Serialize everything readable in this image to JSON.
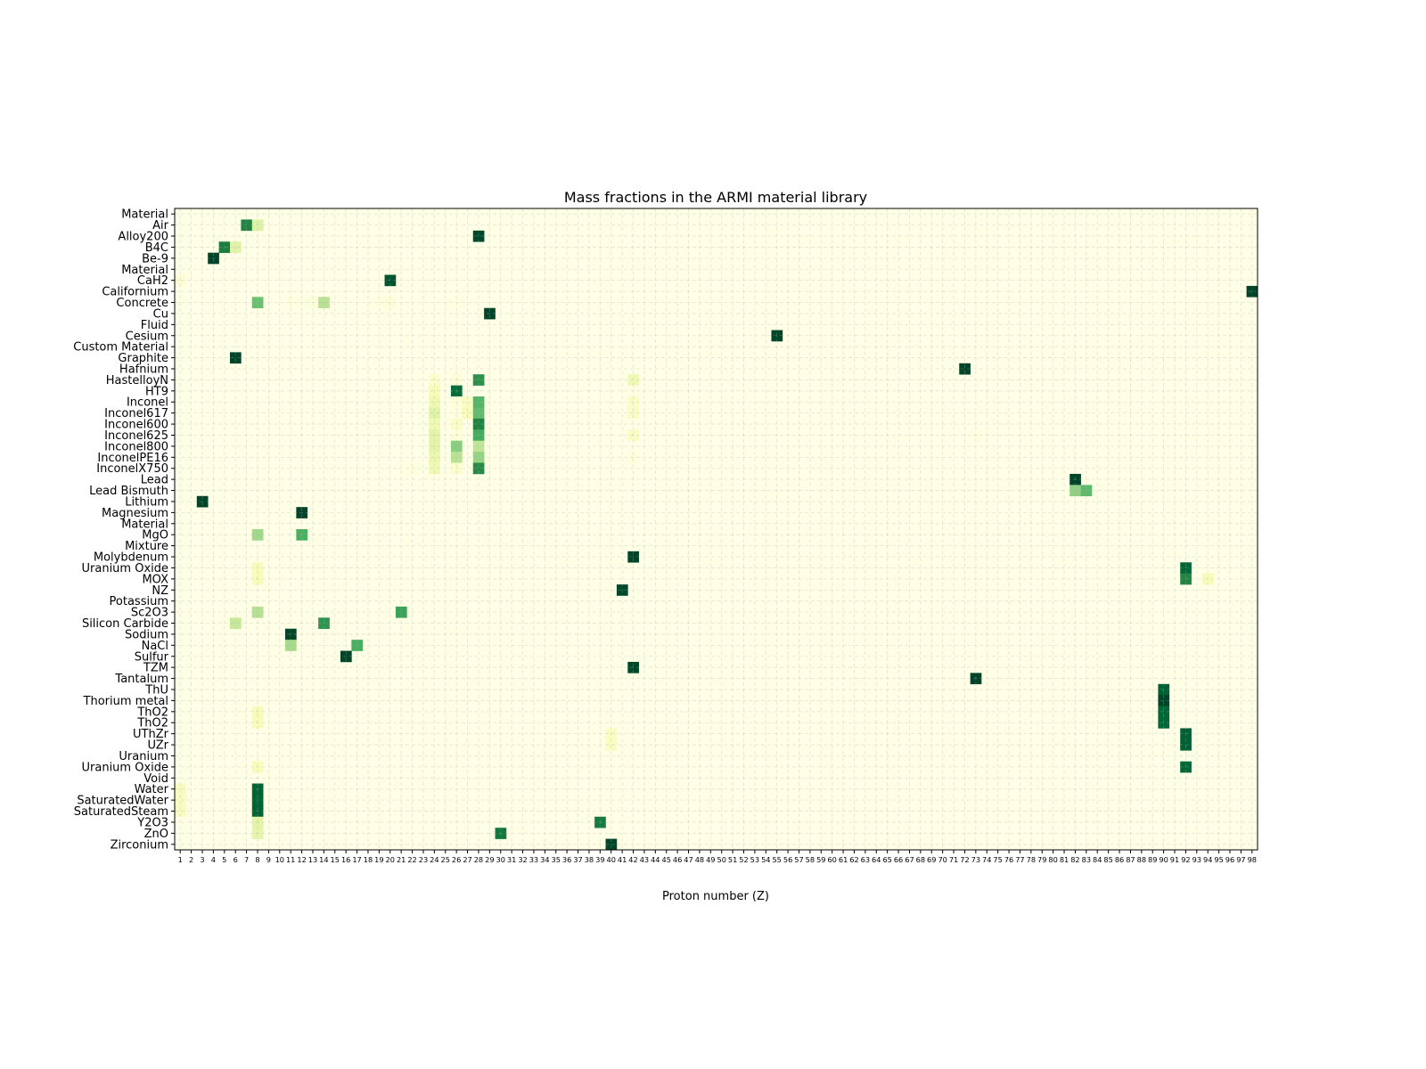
{
  "chart_data": {
    "type": "heatmap",
    "title": "Mass fractions in the ARMI material library",
    "xlabel": "Proton number (Z)",
    "ylabel": "",
    "colormap": "YlGn",
    "value_range": [
      0,
      1
    ],
    "grid": true,
    "x_ticks": [
      1,
      2,
      3,
      4,
      5,
      6,
      7,
      8,
      9,
      10,
      11,
      12,
      13,
      14,
      15,
      16,
      17,
      18,
      19,
      20,
      21,
      22,
      23,
      24,
      25,
      26,
      27,
      28,
      29,
      30,
      31,
      32,
      33,
      34,
      35,
      36,
      37,
      38,
      39,
      40,
      41,
      42,
      43,
      44,
      45,
      46,
      47,
      48,
      49,
      50,
      51,
      52,
      53,
      54,
      55,
      56,
      57,
      58,
      59,
      60,
      61,
      62,
      63,
      64,
      65,
      66,
      67,
      68,
      69,
      70,
      71,
      72,
      73,
      74,
      75,
      76,
      77,
      78,
      79,
      80,
      81,
      82,
      83,
      84,
      85,
      86,
      87,
      88,
      89,
      90,
      91,
      92,
      93,
      94,
      95,
      96,
      97,
      98
    ],
    "rows": [
      {
        "name": "Material",
        "cells": {}
      },
      {
        "name": "Air",
        "cells": {
          "7": 0.755,
          "8": 0.23
        }
      },
      {
        "name": "Alloy200",
        "cells": {
          "28": 0.99
        }
      },
      {
        "name": "B4C",
        "cells": {
          "5": 0.78,
          "6": 0.22
        }
      },
      {
        "name": "Be-9",
        "cells": {
          "4": 1.0
        }
      },
      {
        "name": "Material",
        "cells": {}
      },
      {
        "name": "CaH2",
        "cells": {
          "1": 0.05,
          "20": 0.95
        }
      },
      {
        "name": "Californium",
        "cells": {
          "98": 1.0
        }
      },
      {
        "name": "Concrete",
        "cells": {
          "1": 0.01,
          "8": 0.53,
          "11": 0.02,
          "12": 0.01,
          "13": 0.03,
          "14": 0.34,
          "19": 0.01,
          "20": 0.04,
          "26": 0.01
        }
      },
      {
        "name": "Cu",
        "cells": {
          "29": 1.0
        }
      },
      {
        "name": "Fluid",
        "cells": {}
      },
      {
        "name": "Cesium",
        "cells": {
          "55": 1.0
        }
      },
      {
        "name": "Custom Material",
        "cells": {}
      },
      {
        "name": "Graphite",
        "cells": {
          "6": 1.0
        }
      },
      {
        "name": "Hafnium",
        "cells": {
          "72": 1.0
        }
      },
      {
        "name": "HastelloyN",
        "cells": {
          "24": 0.07,
          "26": 0.04,
          "28": 0.71,
          "42": 0.16
        }
      },
      {
        "name": "HT9",
        "cells": {
          "24": 0.12,
          "26": 0.85,
          "42": 0.01
        }
      },
      {
        "name": "Inconel",
        "cells": {
          "24": 0.16,
          "26": 0.03,
          "27": 0.1,
          "28": 0.58,
          "42": 0.09
        }
      },
      {
        "name": "Inconel617",
        "cells": {
          "24": 0.22,
          "26": 0.02,
          "27": 0.12,
          "28": 0.55,
          "42": 0.09
        }
      },
      {
        "name": "Inconel600",
        "cells": {
          "24": 0.15,
          "26": 0.08,
          "28": 0.76
        }
      },
      {
        "name": "Inconel625",
        "cells": {
          "24": 0.21,
          "26": 0.03,
          "28": 0.62,
          "42": 0.09,
          "73": 0.02
        }
      },
      {
        "name": "Inconel800",
        "cells": {
          "24": 0.21,
          "26": 0.46,
          "28": 0.32
        }
      },
      {
        "name": "InconelPE16",
        "cells": {
          "24": 0.17,
          "26": 0.34,
          "28": 0.43,
          "42": 0.03
        }
      },
      {
        "name": "InconelX750",
        "cells": {
          "24": 0.15,
          "26": 0.07,
          "28": 0.73,
          "22": 0.025
        }
      },
      {
        "name": "Lead",
        "cells": {
          "82": 1.0
        }
      },
      {
        "name": "Lead Bismuth",
        "cells": {
          "82": 0.445,
          "83": 0.555
        }
      },
      {
        "name": "Lithium",
        "cells": {
          "3": 1.0
        }
      },
      {
        "name": "Magnesium",
        "cells": {
          "12": 1.0
        }
      },
      {
        "name": "Material",
        "cells": {}
      },
      {
        "name": "MgO",
        "cells": {
          "8": 0.4,
          "12": 0.6
        }
      },
      {
        "name": "Mixture",
        "cells": {}
      },
      {
        "name": "Molybdenum",
        "cells": {
          "42": 1.0
        }
      },
      {
        "name": "Uranium Oxide",
        "cells": {
          "8": 0.12,
          "92": 0.88
        }
      },
      {
        "name": "MOX",
        "cells": {
          "8": 0.12,
          "92": 0.75,
          "94": 0.13
        }
      },
      {
        "name": "NZ",
        "cells": {
          "41": 0.99
        }
      },
      {
        "name": "Potassium",
        "cells": {}
      },
      {
        "name": "Sc2O3",
        "cells": {
          "8": 0.35,
          "21": 0.65
        }
      },
      {
        "name": "Silicon Carbide",
        "cells": {
          "6": 0.3,
          "14": 0.7
        }
      },
      {
        "name": "Sodium",
        "cells": {
          "11": 1.0
        }
      },
      {
        "name": "NaCl",
        "cells": {
          "11": 0.39,
          "17": 0.61
        }
      },
      {
        "name": "Sulfur",
        "cells": {
          "16": 1.0
        }
      },
      {
        "name": "TZM",
        "cells": {
          "42": 0.99
        }
      },
      {
        "name": "Tantalum",
        "cells": {
          "73": 1.0
        }
      },
      {
        "name": "ThU",
        "cells": {
          "90": 0.9
        }
      },
      {
        "name": "Thorium metal",
        "cells": {
          "90": 1.0
        }
      },
      {
        "name": "ThO2",
        "cells": {
          "8": 0.12,
          "90": 0.88
        }
      },
      {
        "name": "ThO2",
        "cells": {
          "8": 0.12,
          "90": 0.88
        }
      },
      {
        "name": "UThZr",
        "cells": {
          "40": 0.1,
          "92": 0.9
        }
      },
      {
        "name": "UZr",
        "cells": {
          "40": 0.1,
          "92": 0.9
        }
      },
      {
        "name": "Uranium",
        "cells": {}
      },
      {
        "name": "Uranium Oxide",
        "cells": {
          "8": 0.12,
          "92": 0.88
        }
      },
      {
        "name": "Void",
        "cells": {}
      },
      {
        "name": "Water",
        "cells": {
          "1": 0.11,
          "8": 0.89
        }
      },
      {
        "name": "SaturatedWater",
        "cells": {
          "1": 0.11,
          "8": 0.89
        }
      },
      {
        "name": "SaturatedSteam",
        "cells": {
          "1": 0.11,
          "8": 0.89
        }
      },
      {
        "name": "Y2O3",
        "cells": {
          "8": 0.21,
          "39": 0.79
        }
      },
      {
        "name": "ZnO",
        "cells": {
          "8": 0.2,
          "30": 0.8
        }
      },
      {
        "name": "Zirconium",
        "cells": {
          "40": 1.0
        }
      }
    ]
  }
}
